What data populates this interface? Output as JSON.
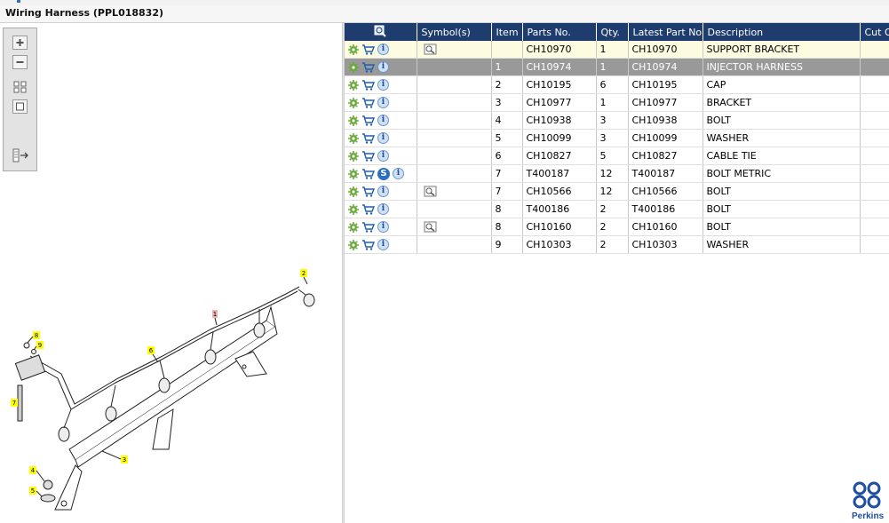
{
  "window": {
    "title": "Wiring Harness (PPL018832)"
  },
  "toolbox": {
    "buttons": [
      "zoom-in",
      "zoom-out",
      "fit-all",
      "fit-window",
      "toggle-panel"
    ]
  },
  "callouts": [
    "1",
    "2",
    "3",
    "4",
    "5",
    "6",
    "7",
    "8",
    "9"
  ],
  "grid": {
    "headers": {
      "magnifier": "search-icon",
      "symbols": "Symbol(s)",
      "item": "Item",
      "parts_no": "Parts No.",
      "qty": "Qty.",
      "latest": "Latest Part No.",
      "description": "Description",
      "cut": "Cut O"
    },
    "rows": [
      {
        "item": "",
        "parts": "CH10970",
        "qty": "1",
        "latest": "CH10970",
        "desc": "SUPPORT BRACKET",
        "symbol": true,
        "s": false,
        "state": "hl"
      },
      {
        "item": "1",
        "parts": "CH10974",
        "qty": "1",
        "latest": "CH10974",
        "desc": "INJECTOR HARNESS",
        "symbol": false,
        "s": false,
        "state": "sel"
      },
      {
        "item": "2",
        "parts": "CH10195",
        "qty": "6",
        "latest": "CH10195",
        "desc": "CAP",
        "symbol": false,
        "s": false,
        "state": ""
      },
      {
        "item": "3",
        "parts": "CH10977",
        "qty": "1",
        "latest": "CH10977",
        "desc": "BRACKET",
        "symbol": false,
        "s": false,
        "state": ""
      },
      {
        "item": "4",
        "parts": "CH10938",
        "qty": "3",
        "latest": "CH10938",
        "desc": "BOLT",
        "symbol": false,
        "s": false,
        "state": ""
      },
      {
        "item": "5",
        "parts": "CH10099",
        "qty": "3",
        "latest": "CH10099",
        "desc": "WASHER",
        "symbol": false,
        "s": false,
        "state": ""
      },
      {
        "item": "6",
        "parts": "CH10827",
        "qty": "5",
        "latest": "CH10827",
        "desc": "CABLE TIE",
        "symbol": false,
        "s": false,
        "state": ""
      },
      {
        "item": "7",
        "parts": "T400187",
        "qty": "12",
        "latest": "T400187",
        "desc": "BOLT METRIC",
        "symbol": false,
        "s": true,
        "state": ""
      },
      {
        "item": "7",
        "parts": "CH10566",
        "qty": "12",
        "latest": "CH10566",
        "desc": "BOLT",
        "symbol": true,
        "s": false,
        "state": ""
      },
      {
        "item": "8",
        "parts": "T400186",
        "qty": "2",
        "latest": "T400186",
        "desc": "BOLT",
        "symbol": false,
        "s": false,
        "state": ""
      },
      {
        "item": "8",
        "parts": "CH10160",
        "qty": "2",
        "latest": "CH10160",
        "desc": "BOLT",
        "symbol": true,
        "s": false,
        "state": ""
      },
      {
        "item": "9",
        "parts": "CH10303",
        "qty": "2",
        "latest": "CH10303",
        "desc": "WASHER",
        "symbol": false,
        "s": false,
        "state": ""
      }
    ],
    "info_glyph": "i",
    "s_glyph": "S"
  },
  "brand": {
    "name": "Perkins",
    "color": "#1e4fa0"
  }
}
